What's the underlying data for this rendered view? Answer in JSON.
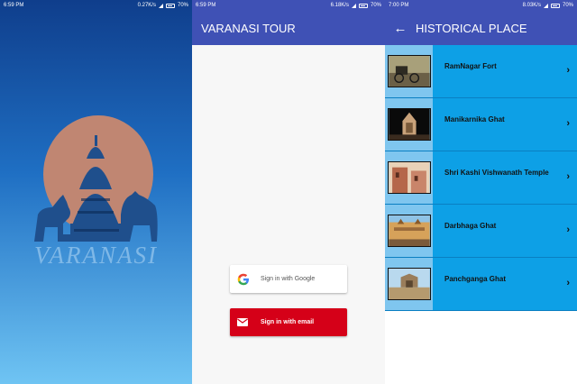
{
  "screen1": {
    "status_time": "6:59 PM",
    "status_right": "0.27K/s",
    "battery": "70%",
    "brand": "VARANASI"
  },
  "screen2": {
    "status_time": "6:59 PM",
    "status_right": "6.18K/s",
    "battery": "70%",
    "title": "VARANASI TOUR",
    "google_button": "Sign in with Google",
    "email_button": "Sign in with email",
    "colors": {
      "appbar": "#3f51b5",
      "email": "#d50018"
    }
  },
  "screen3": {
    "status_time": "7:00 PM",
    "status_right": "8.03K/s",
    "battery": "70%",
    "title": "HISTORICAL PLACE",
    "back_icon": "arrow-back-icon",
    "places": [
      {
        "name": "RamNagar Fort"
      },
      {
        "name": "Manikarnika Ghat"
      },
      {
        "name": "Shri Kashi Vishwanath Temple"
      },
      {
        "name": "Darbhaga Ghat"
      },
      {
        "name": "Panchganga Ghat"
      }
    ],
    "colors": {
      "row": "#0da0e6"
    }
  }
}
